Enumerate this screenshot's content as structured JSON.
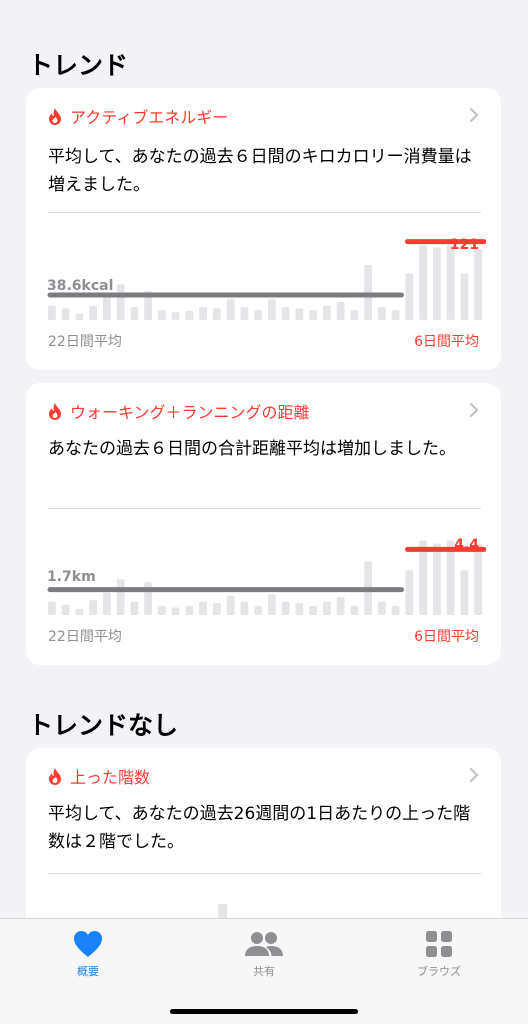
{
  "colors": {
    "accent": "#ff3b30",
    "bar": "#e4e4e9",
    "avg_line": "#7c7c80",
    "tab_active": "#1a82fb",
    "tab_inactive": "#8e8e93"
  },
  "sections": {
    "trends_title": "トレンド",
    "no_trends_title": "トレンドなし"
  },
  "cards": [
    {
      "category": "アクティブエネルギー",
      "description": "平均して、あなたの過去６日間のキロカロリー消費量は増えました。",
      "baseline_label": "38.6kcal",
      "recent_value_label": "121",
      "footer_left": "22日間平均",
      "footer_right": "6日間平均",
      "chart_data": {
        "type": "bar",
        "baseline_average": 38.6,
        "recent_average": 121,
        "baseline_days": 22,
        "recent_days": 6,
        "values": [
          22,
          18,
          10,
          22,
          35,
          55,
          20,
          45,
          15,
          12,
          14,
          20,
          18,
          32,
          20,
          15,
          32,
          20,
          18,
          15,
          22,
          28,
          15,
          85,
          20,
          15,
          72,
          115,
          112,
          115,
          72,
          110
        ]
      }
    },
    {
      "category": "ウォーキング＋ランニングの距離",
      "description": "あなたの過去６日間の合計距離平均は増加しました。",
      "baseline_label": "1.7km",
      "recent_value_label": "4.4",
      "footer_left": "22日間平均",
      "footer_right": "6日間平均",
      "chart_data": {
        "type": "bar",
        "baseline_average": 1.7,
        "recent_average": 4.4,
        "baseline_days": 22,
        "recent_days": 6,
        "values": [
          0.9,
          0.7,
          0.4,
          1.0,
          1.5,
          2.4,
          0.9,
          2.2,
          0.6,
          0.5,
          0.6,
          0.9,
          0.8,
          1.3,
          0.9,
          0.6,
          1.4,
          0.9,
          0.8,
          0.6,
          0.9,
          1.2,
          0.6,
          3.6,
          0.9,
          0.6,
          3.0,
          5.0,
          4.8,
          5.0,
          3.0,
          4.8
        ]
      }
    },
    {
      "category": "上った階数",
      "description": "平均して、あなたの過去26週間の1日あたりの上った階数は２階でした。"
    }
  ],
  "tabs": [
    {
      "label": "概要",
      "icon": "heart-icon"
    },
    {
      "label": "共有",
      "icon": "people-icon"
    },
    {
      "label": "ブラウズ",
      "icon": "grid-icon"
    }
  ]
}
